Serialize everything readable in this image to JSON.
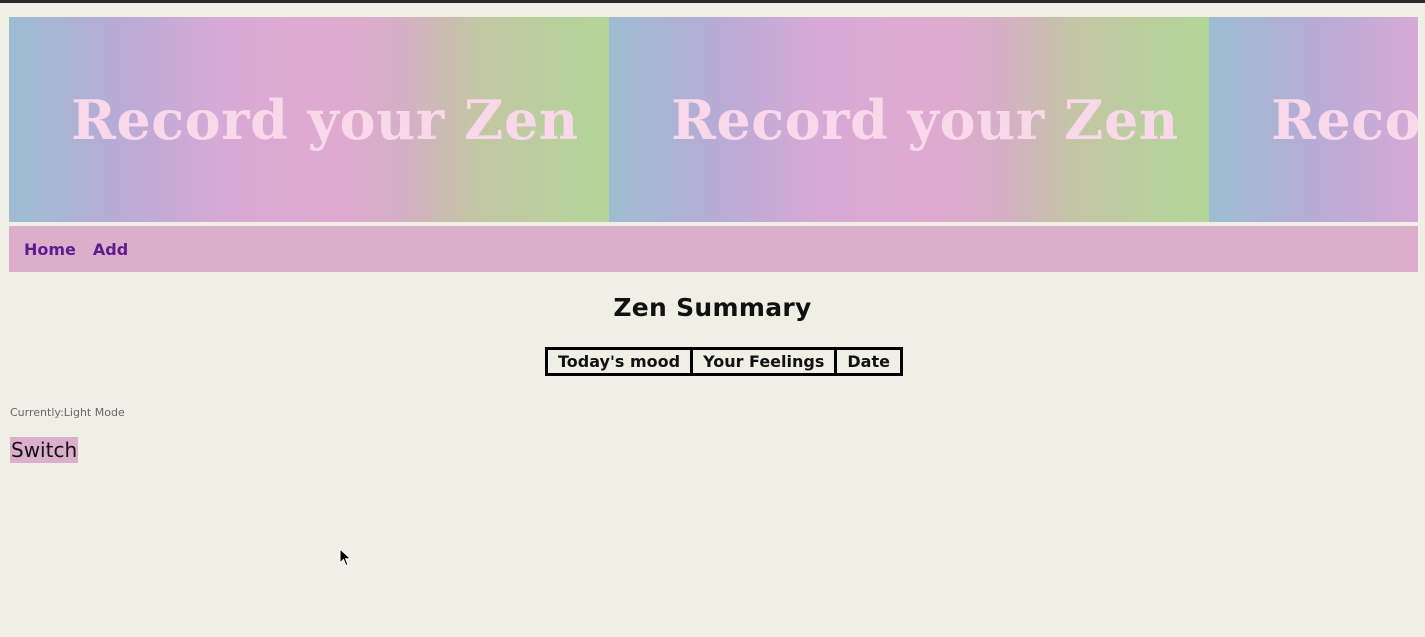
{
  "banner": {
    "tiles": [
      "Record your Zen",
      "Record your Zen",
      "Record your Zen"
    ]
  },
  "nav": {
    "items": [
      {
        "label": "Home"
      },
      {
        "label": "Add"
      }
    ]
  },
  "main": {
    "title": "Zen Summary",
    "table": {
      "headers": [
        "Today's mood",
        "Your Feelings",
        "Date"
      ]
    }
  },
  "theme": {
    "mode_label": "Currently:Light Mode",
    "switch_label": "Switch"
  },
  "colors": {
    "background": "#f0efe6",
    "nav_background": "#dbafcc",
    "nav_link": "#5e1c8f",
    "banner_text": "#f9d8ea"
  },
  "icons": {
    "cursor": "mouse-pointer-icon"
  }
}
